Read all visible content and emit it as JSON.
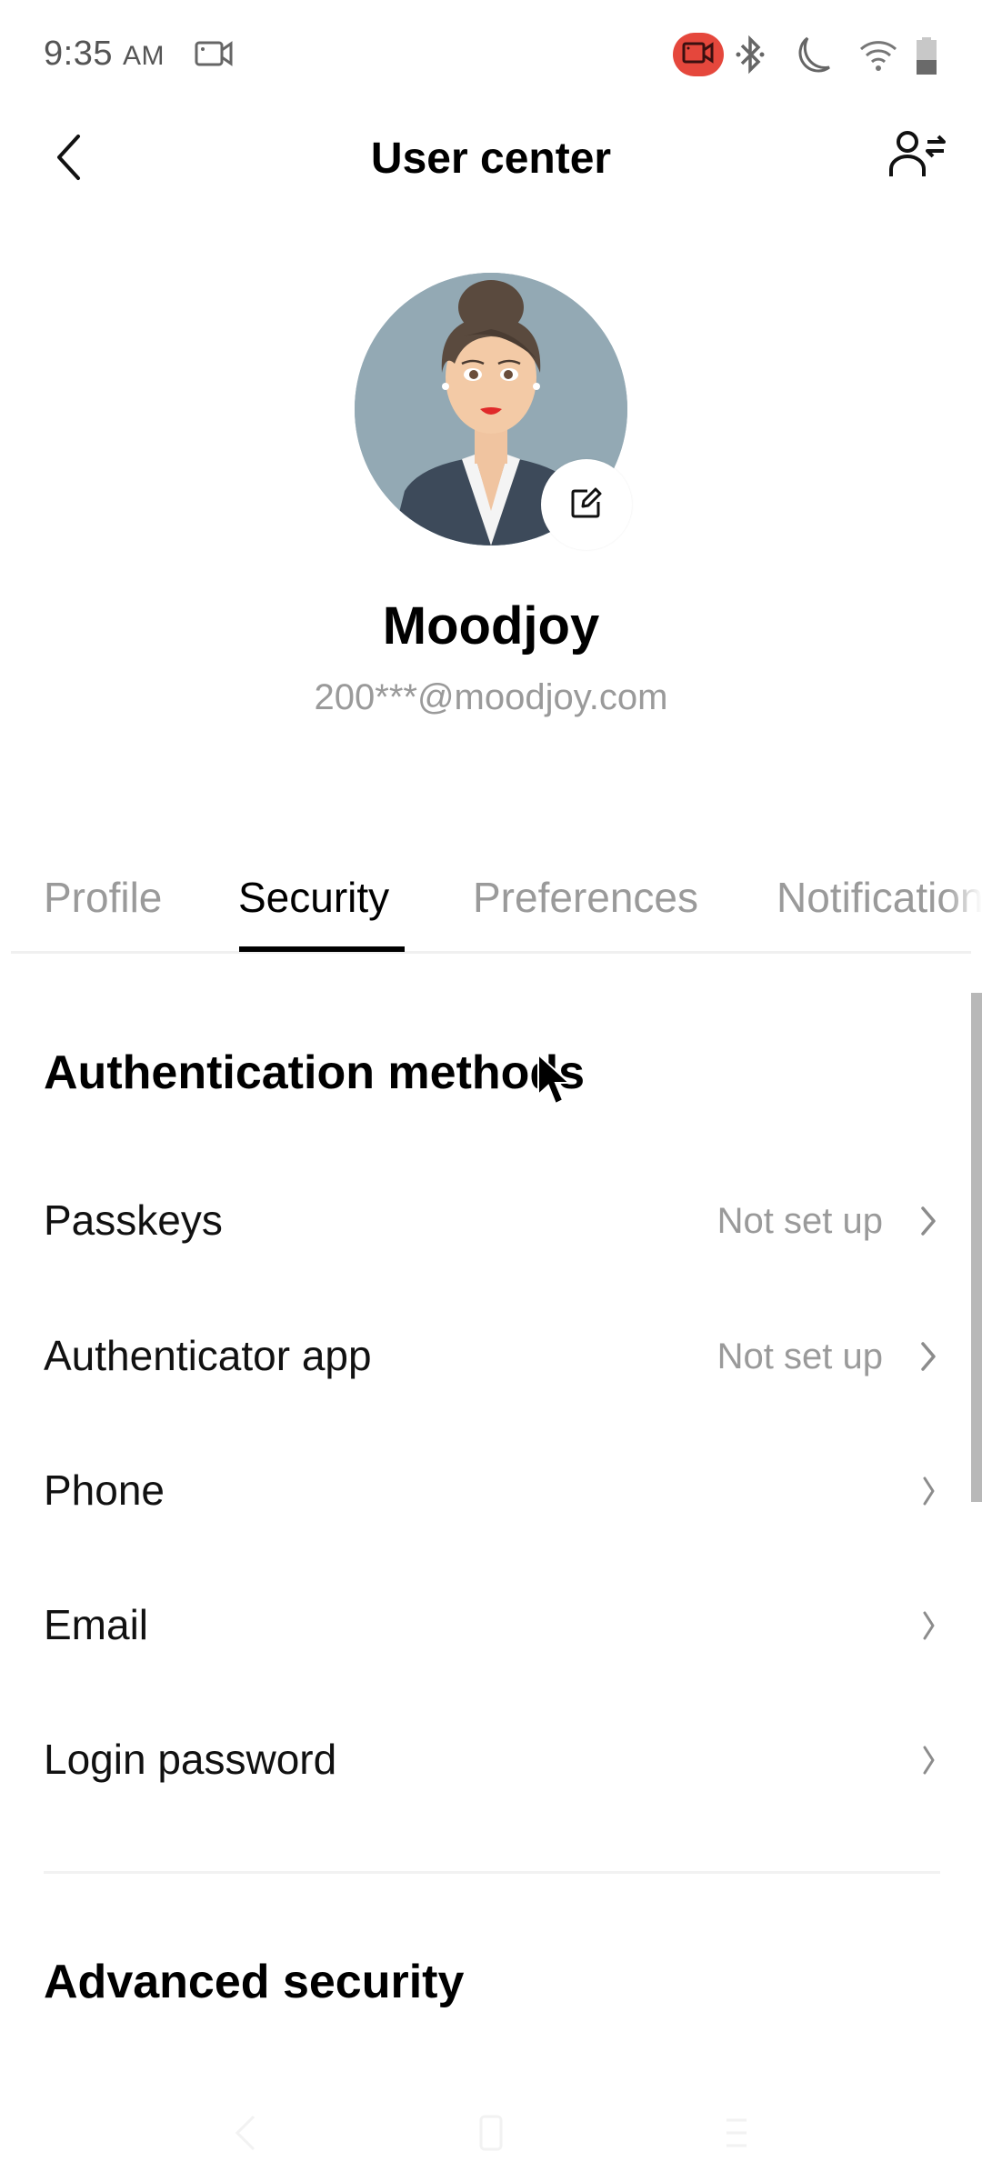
{
  "status_bar": {
    "time": "9:35",
    "ampm": "AM",
    "icons": [
      "video-camera-icon",
      "screen-record-icon",
      "bluetooth-icon",
      "do-not-disturb-moon-icon",
      "wifi-icon",
      "battery-icon"
    ],
    "record_color": "#e5473c"
  },
  "header": {
    "title": "User center",
    "back_icon": "back-chevron-icon",
    "switch_account_icon": "switch-account-icon"
  },
  "profile": {
    "name": "Moodjoy",
    "email": "200***@moodjoy.com",
    "edit_icon": "edit-icon"
  },
  "tabs": {
    "items": [
      {
        "label": "Profile",
        "active": false
      },
      {
        "label": "Security",
        "active": true
      },
      {
        "label": "Preferences",
        "active": false
      },
      {
        "label": "Notifications",
        "active": false
      }
    ]
  },
  "authentication": {
    "title": "Authentication methods",
    "rows": [
      {
        "label": "Passkeys",
        "value": "Not set up"
      },
      {
        "label": "Authenticator app",
        "value": "Not set up"
      },
      {
        "label": "Phone",
        "value": ""
      },
      {
        "label": "Email",
        "value": ""
      },
      {
        "label": "Login password",
        "value": ""
      }
    ]
  },
  "advanced": {
    "title": "Advanced security"
  },
  "nav_bar": {
    "icons": [
      "nav-back-icon",
      "nav-home-icon",
      "nav-menu-icon"
    ]
  }
}
